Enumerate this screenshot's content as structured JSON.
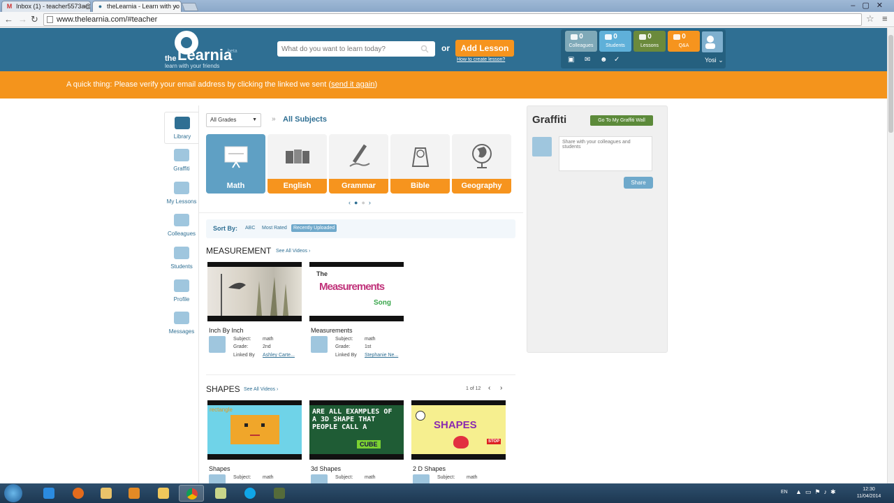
{
  "browser": {
    "tabs": [
      {
        "label": "Inbox (1) - teacher5573a@",
        "favicon": "gmail-icon"
      },
      {
        "label": "theLearnia - Learn with yo",
        "favicon": "learnia-icon"
      }
    ],
    "url": "www.thelearnia.com/#teacher"
  },
  "header": {
    "logo_the": "the",
    "logo_name": "Learnia",
    "logo_beta": "beta",
    "logo_tagline": "learn with your friends",
    "search_placeholder": "What do you want to learn today?",
    "or_text": "or",
    "add_lesson": "Add Lesson",
    "how_to": "How to create lesson?",
    "stats": [
      {
        "count": "0",
        "label": "Colleagues",
        "color": "#7fa9b8"
      },
      {
        "count": "0",
        "label": "Students",
        "color": "#5fb0d9"
      },
      {
        "count": "0",
        "label": "Lessons",
        "color": "#6b8a3c"
      },
      {
        "count": "0",
        "label": "Q&A",
        "color": "#f6941e"
      }
    ],
    "user": "Yosi"
  },
  "banner": {
    "text": "A quick thing: Please verify your email address by clicking the linked we sent (",
    "link": "send it again",
    "end": ")"
  },
  "nav": [
    {
      "label": "Library"
    },
    {
      "label": "Graffiti"
    },
    {
      "label": "My Lessons"
    },
    {
      "label": "Colleagues"
    },
    {
      "label": "Students"
    },
    {
      "label": "Profile"
    },
    {
      "label": "Messages"
    }
  ],
  "filters": {
    "grade": "All Grades",
    "subject": "All Subjects"
  },
  "subjects": [
    {
      "label": "Math"
    },
    {
      "label": "English"
    },
    {
      "label": "Grammar"
    },
    {
      "label": "Bible"
    },
    {
      "label": "Geography"
    }
  ],
  "sort": {
    "label": "Sort By:",
    "options": [
      "ABC",
      "Most Rated",
      "Recently Uploaded"
    ]
  },
  "sections": [
    {
      "title": "MEASUREMENT",
      "see_all": "See All Videos",
      "videos": [
        {
          "title": "Inch By Inch",
          "subject": "math",
          "grade": "2nd",
          "linked_by": "Ashley Carte..."
        },
        {
          "title": "Measurements",
          "subject": "math",
          "grade": "1st",
          "linked_by": "Stephanie Ne..."
        }
      ]
    },
    {
      "title": "SHAPES",
      "see_all": "See All Videos",
      "pager": "1 of 12",
      "videos": [
        {
          "title": "Shapes",
          "subject": "math"
        },
        {
          "title": "3d Shapes",
          "subject": "math"
        },
        {
          "title": "2 D Shapes",
          "subject": "math"
        }
      ]
    }
  ],
  "meta_labels": {
    "subject": "Subject:",
    "grade": "Grade:",
    "linked_by": "Linked By"
  },
  "thumb_text": {
    "measure_1": "The",
    "measure_2": "Measurements",
    "measure_3": "Song",
    "shape_1": "rectangle",
    "shape_3d": "ARE ALL EXAMPLES OF A 3D SHAPE THAT PEOPLE CALL A",
    "shape_3d_cube": "CUBE",
    "shape_2d": "SHAPES",
    "shape_2d_stop": "STOP"
  },
  "graffiti": {
    "title": "Graffiti",
    "wall_button": "Go To My Graffiti Wall",
    "placeholder": "Share with your colleagues and students",
    "share": "Share"
  },
  "taskbar": {
    "lang": "EN",
    "time": "12:30",
    "date": "11/04/2014"
  }
}
